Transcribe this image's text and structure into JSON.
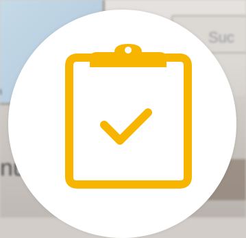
{
  "background": {
    "texts": {
      "success_fragment": "Suc",
      "left_fragment": "n",
      "menu_fragment": "nu"
    }
  },
  "badge": {
    "icon": "clipboard-check-icon",
    "colors": {
      "icon": "#F7B500",
      "circle": "#FFFFFF"
    }
  }
}
